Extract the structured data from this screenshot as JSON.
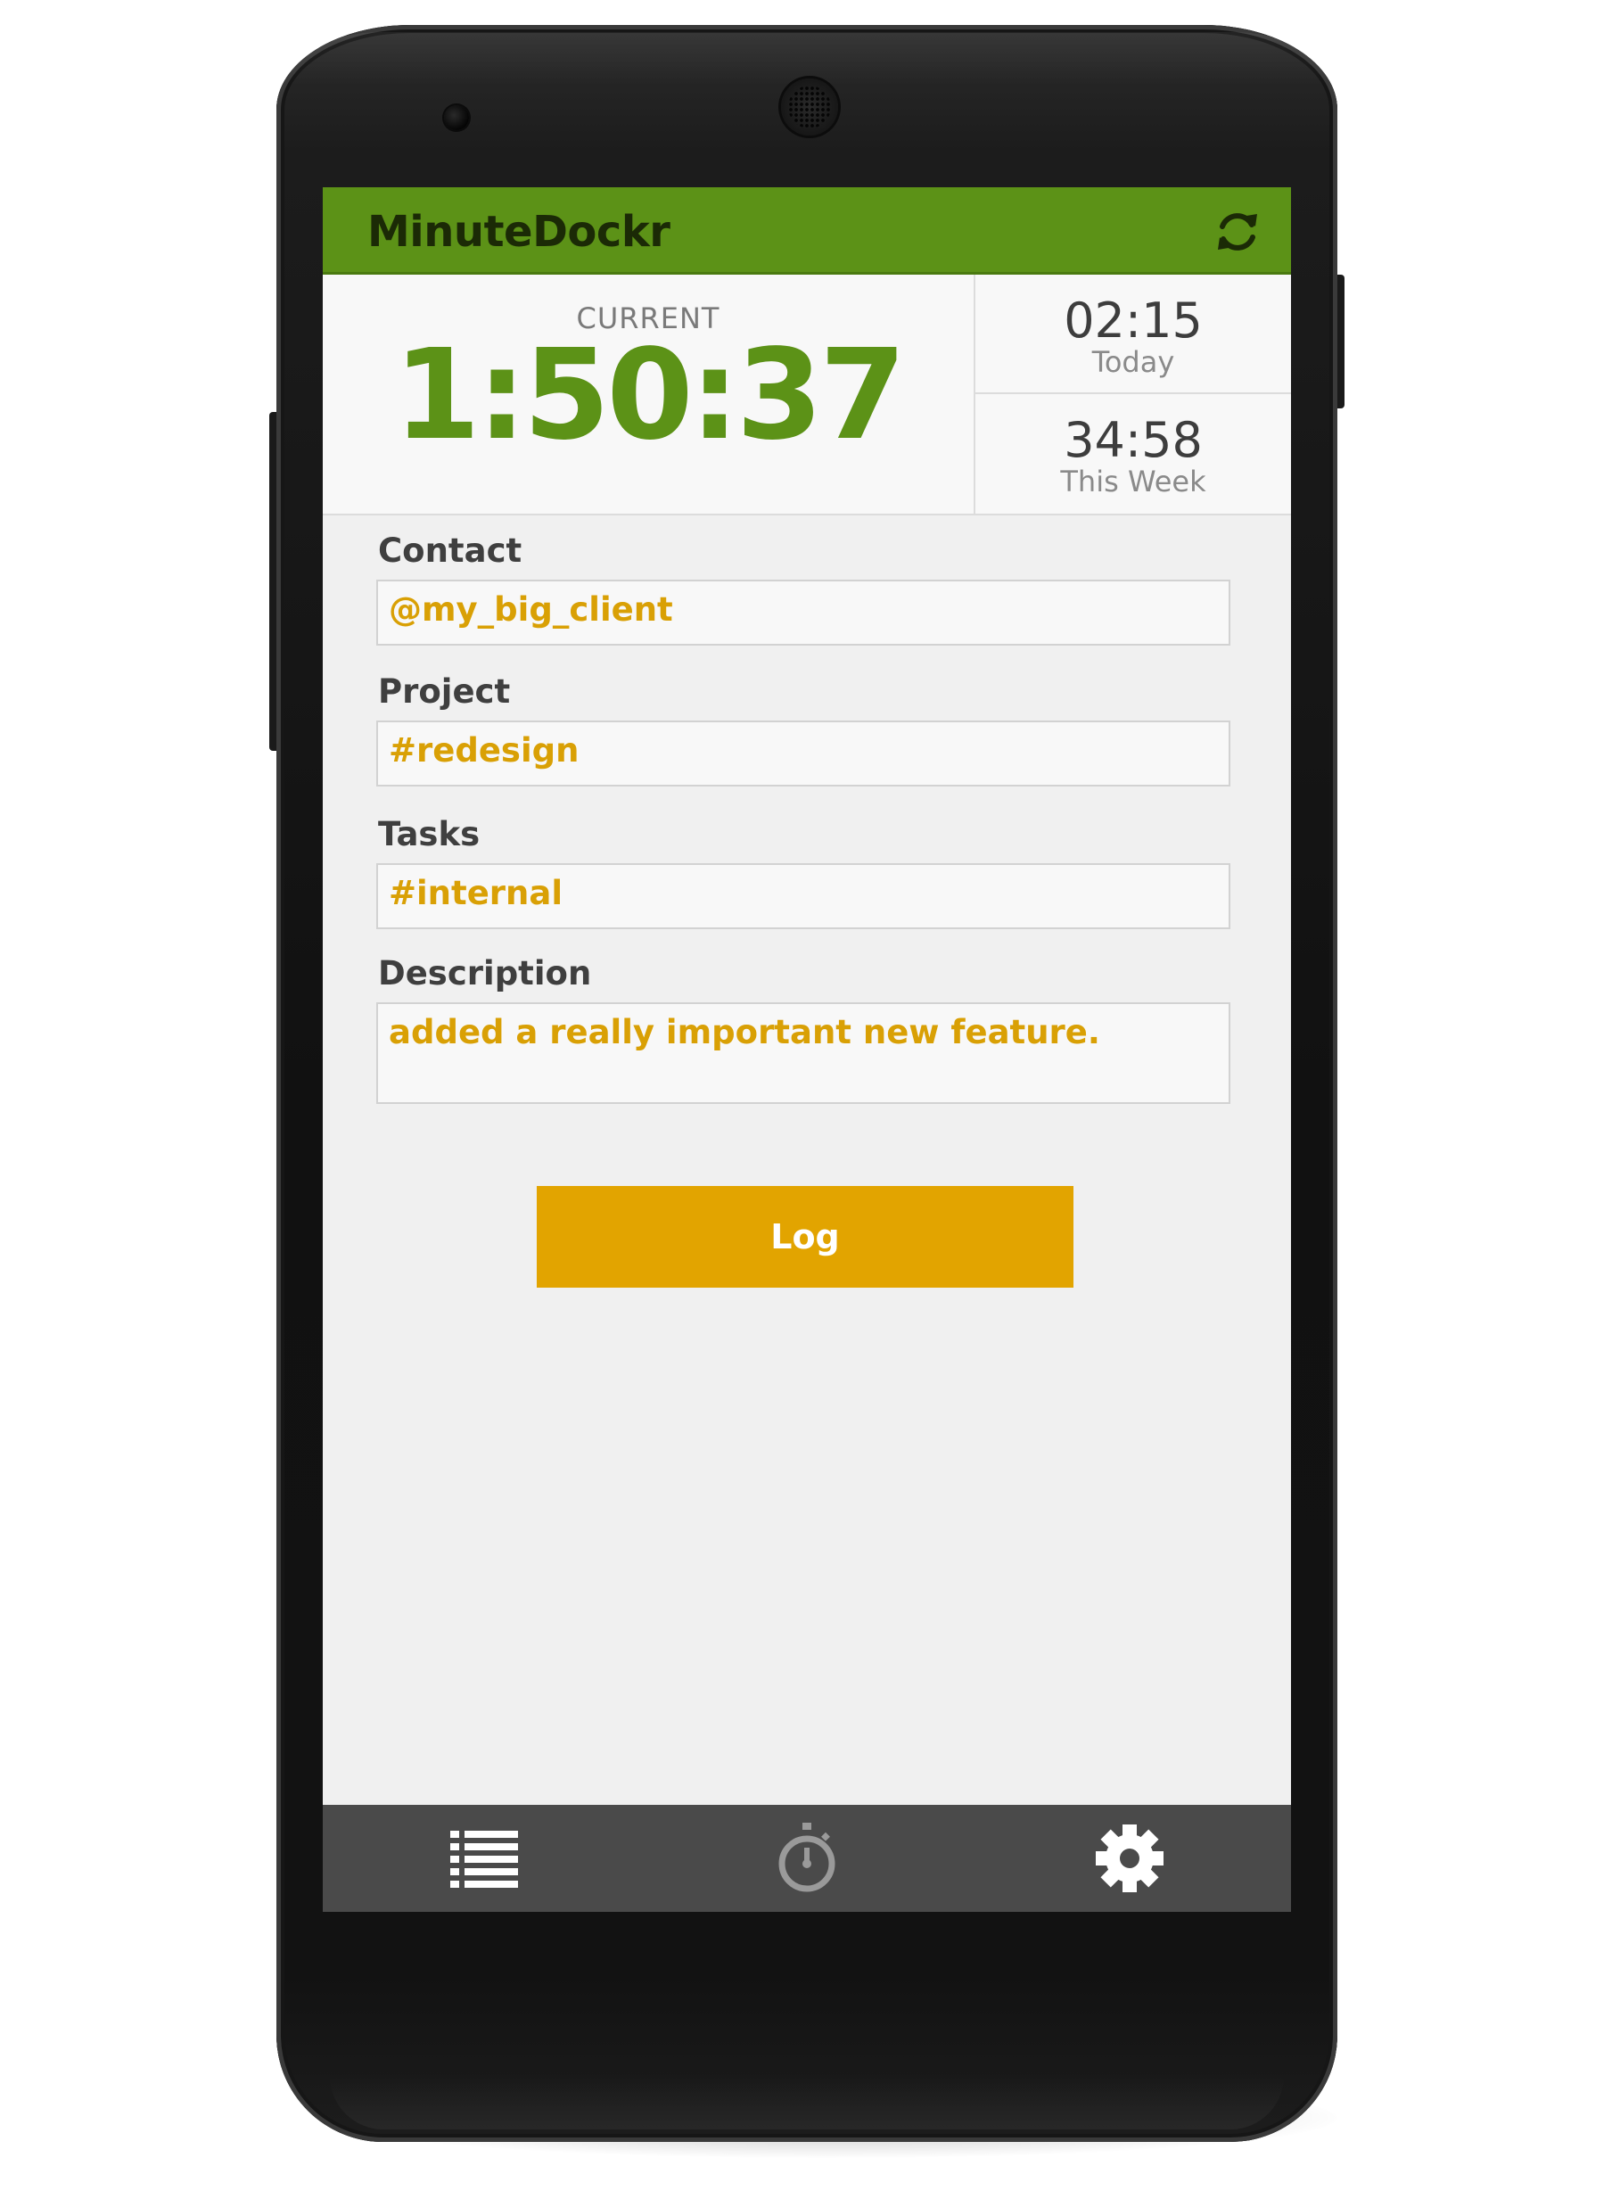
{
  "app": {
    "title": "MinuteDockr",
    "refresh_icon": "refresh-icon",
    "accent_color": "#5c9217",
    "highlight_color": "#e2a400"
  },
  "timers": {
    "current_label": "CURRENT",
    "current_value": "1:50:37",
    "today_value": "02:15",
    "today_label": "Today",
    "week_value": "34:58",
    "week_label": "This Week"
  },
  "form": {
    "contact": {
      "label": "Contact",
      "value": "@my_big_client"
    },
    "project": {
      "label": "Project",
      "value": "#redesign"
    },
    "tasks": {
      "label": "Tasks",
      "value": "#internal"
    },
    "description": {
      "label": "Description",
      "value": "added a really important new feature."
    },
    "log_button": "Log"
  },
  "nav": {
    "items": [
      {
        "name": "entries",
        "icon": "list-icon"
      },
      {
        "name": "timer",
        "icon": "stopwatch-icon"
      },
      {
        "name": "settings",
        "icon": "gear-icon"
      }
    ]
  }
}
